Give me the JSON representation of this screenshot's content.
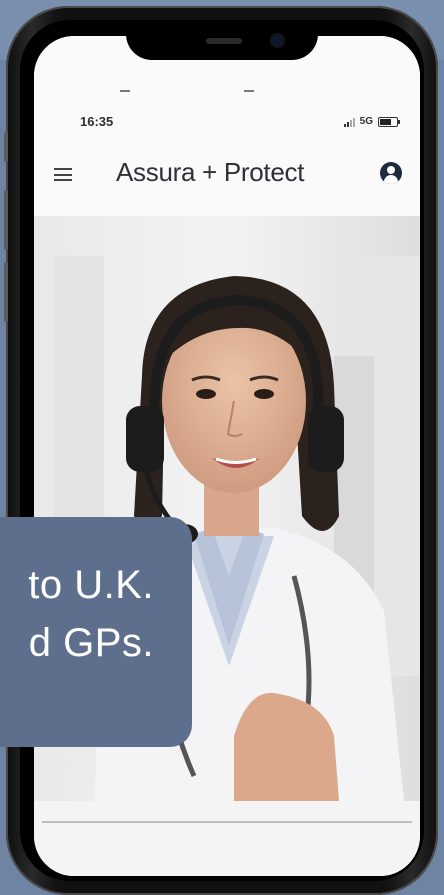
{
  "status_bar": {
    "time": "16:35",
    "network": "5G"
  },
  "app_bar": {
    "title": "Assura + Protect",
    "menu_icon": "hamburger-menu-icon",
    "account_icon": "account-circle-icon"
  },
  "hero": {
    "image": "doctor-with-headset-video-call"
  },
  "caption": {
    "line1": "to U.K.",
    "line2": "d GPs."
  },
  "colors": {
    "background": "#6f84a3",
    "caption_bg": "#5e6f8e",
    "phone_frame": "#111111"
  }
}
